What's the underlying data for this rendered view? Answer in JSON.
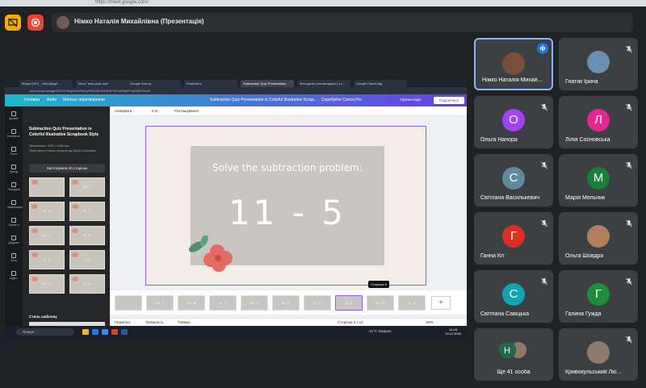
{
  "browser": {
    "url": "https://meet.google.com/"
  },
  "topbar": {
    "presenter_label": "Німко Наталія Михайлівна (Презентація)"
  },
  "shared_screen": {
    "tabs": [
      "Вхідні (597) - ninko@ppt...",
      "Месс \"ваш урок ask\"",
      "Google Ілюстр",
      "EduBrains",
      "Subtraction Quiz Presentation",
      "Методичні рекомендації | 4 к...",
      "Google Переклад"
    ],
    "address": "canva.com/design/DAFcK3bgc/n/dM0UsyRfWzEmZuhFeFZbXu8GjbE7rgKMBlY/edit",
    "canva_menu": [
      "Головна",
      "Файл",
      "Магічне перетворення",
      "Subtraction Quiz Presentation in Colorful Illustrative Scrap...",
      "Спробуйте Canva Pro"
    ],
    "canva_present": "Презентація",
    "canva_share": "Поділитися",
    "rail": [
      "Дизайн",
      "Елементи",
      "Текст",
      "Бренд",
      "Передані",
      "Завантаження",
      "Проєкти",
      "Додатки",
      "Фото",
      "Відео"
    ],
    "panel": {
      "title": "Subtraction Quiz Presentation in Colorful Illustrative Scrapbook Style",
      "subtitle": "Презентація • 1920 × 1080 пікс",
      "creator": "Переглянути більше ресурсів від Taylor A Education",
      "apply": "Застосувати 10 сторінок",
      "thumbs": [
        "",
        "20 - 7",
        "11 - 5",
        "8 - 7",
        "10 - 1",
        "9 - 2",
        "3 - 3",
        "1 - 5",
        "20 - 17",
        "8 - 3"
      ],
      "style_heading": "Стиль шаблону",
      "style_name": "KG Primary Penmanship"
    },
    "toolbar": {
      "animate": "Анімувати",
      "duration": "5.0с",
      "tidy": "Розташування"
    },
    "slide": {
      "question": "Solve the subtraction problem:",
      "equation": "11 - 5"
    },
    "filmstrip": [
      "",
      "20 - 7",
      "11 - 5",
      "8 - 7",
      "10 - 1",
      "9 - 2",
      "3 - 3",
      "1 - 5",
      "20 - 17",
      "8 - 3"
    ],
    "tooltip": "Сторінка 8",
    "footer": {
      "notes": "Примітки",
      "duration": "Тривалість",
      "timer": "Таймер",
      "page": "Сторінка 8 з 10",
      "zoom": "80%"
    },
    "taskbar": {
      "search": "Пошук",
      "weather": "-11°C Хмарно",
      "time": "14:18",
      "date": "13.12.2022"
    }
  },
  "participants": [
    {
      "name": "Німко Наталія Михай...",
      "type": "photo",
      "active": true
    },
    {
      "name": "Гнатик Ірина",
      "type": "photo"
    },
    {
      "name": "Ольга Напора",
      "initial": "О",
      "color": "#a142f4"
    },
    {
      "name": "Лілія Сосновська",
      "initial": "Л",
      "color": "#e52592"
    },
    {
      "name": "Світлана Василькевич",
      "initial": "С",
      "color": "#5f8a9e"
    },
    {
      "name": "Марія Мельник",
      "initial": "М",
      "color": "#188038"
    },
    {
      "name": "Ганна Кіт",
      "initial": "Г",
      "color": "#d93025"
    },
    {
      "name": "Ольга Шовдра",
      "type": "photo"
    },
    {
      "name": "Світлана Савіцька",
      "initial": "С",
      "color": "#12a4af"
    },
    {
      "name": "Галина Гужда",
      "initial": "Г",
      "color": "#1e8e3e"
    },
    {
      "name": "Ще 41 особа",
      "type": "more",
      "initial": "Н"
    },
    {
      "name": "Кривокульський Лю...",
      "type": "photo"
    }
  ],
  "colors": {
    "background": "#202124",
    "tile": "#3c4043",
    "accent": "#8ab4f8",
    "canva_purple": "#8b5cf6"
  }
}
